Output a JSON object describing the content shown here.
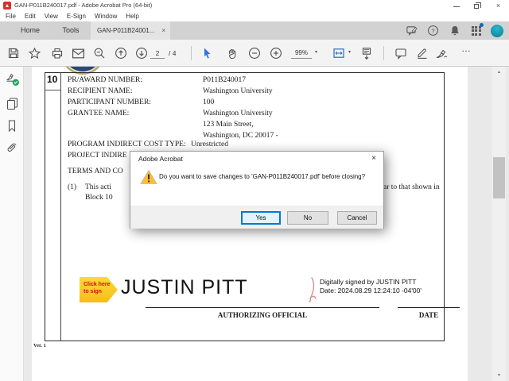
{
  "window": {
    "title": "GAN-P011B240017.pdf - Adobe Acrobat Pro (64-bit)"
  },
  "menu_bar": {
    "items": [
      "File",
      "Edit",
      "View",
      "E-Sign",
      "Window",
      "Help"
    ]
  },
  "tab_bar": {
    "tabs": [
      {
        "label": "Home"
      },
      {
        "label": "Tools"
      },
      {
        "label": "GAN-P011B24001...",
        "active": true
      }
    ]
  },
  "toolbar": {
    "page_current": "2",
    "page_total": "/ 4",
    "zoom_level": "99%"
  },
  "icons": {
    "close_glyph": "×",
    "caret_down": "▾",
    "more_ellipsis": "…",
    "scroll_up": "▲",
    "scroll_down": "▼",
    "names": [
      "save-icon",
      "star-icon",
      "print-icon",
      "email-icon",
      "search-icon",
      "page-up-icon",
      "page-down-icon",
      "select-tool-icon",
      "hand-tool-icon",
      "zoom-out-icon",
      "zoom-in-icon",
      "fit-width-icon",
      "page-display-icon",
      "comment-icon",
      "highlight-icon",
      "sign-icon",
      "feedback-icon",
      "help-icon",
      "bell-icon",
      "apps-grid-icon",
      "avatar",
      "esign-check-icon",
      "pages-icon",
      "bookmark-icon",
      "paperclip-icon",
      "warning-icon",
      "ribbon-icon",
      "seal-fragment"
    ]
  },
  "document": {
    "block_number": "10",
    "fields": [
      {
        "label": "PR/AWARD NUMBER:",
        "value": "P011B240017"
      },
      {
        "label": "RECIPIENT NAME:",
        "value": "Washington University"
      },
      {
        "label": "PARTICIPANT NUMBER:",
        "value": "100"
      },
      {
        "label": "GRANTEE NAME:",
        "value": "Washington University"
      }
    ],
    "grantee_address": [
      "123 Main Street,",
      "Washington, DC 20017 -"
    ],
    "program_line": {
      "label": "PROGRAM INDIRECT COST TYPE:",
      "value": "Unrestricted"
    },
    "project_line_fragment": "PROJECT INDIRE",
    "terms_fragment": "TERMS AND CO",
    "clause_number": "(1)",
    "clause_left_fragment": "This acti",
    "clause_right_fragment": "t year to that shown in",
    "clause_block_fragment": "Block 10",
    "signature": {
      "tag_line1": "Click here",
      "tag_line2": "to sign",
      "name": "JUSTIN PITT",
      "digital_line1": "Digitally signed by JUSTIN PITT",
      "digital_line2": "Date: 2024.08.29 12:24:10 -04'00'"
    },
    "authorizing_label": "AUTHORIZING OFFICIAL",
    "date_label": "DATE",
    "version": "Ver. 1"
  },
  "dialog": {
    "title": "Adobe Acrobat",
    "message": "Do you want to save changes to 'GAN-P011B240017.pdf' before closing?",
    "buttons": [
      {
        "label": "Yes",
        "default": true
      },
      {
        "label": "No"
      },
      {
        "label": "Cancel"
      }
    ]
  },
  "colors": {
    "accent_blue": "#0078d7",
    "select_tool_blue": "#3672e0",
    "warning_yellow": "#fdbf2d",
    "sign_tag_yellow": "#f7bd17",
    "sign_tag_text_red": "#cc1111",
    "seal_navy": "#16305a",
    "avatar_teal": "#149aae",
    "ribbon_red": "#d98f8f"
  }
}
